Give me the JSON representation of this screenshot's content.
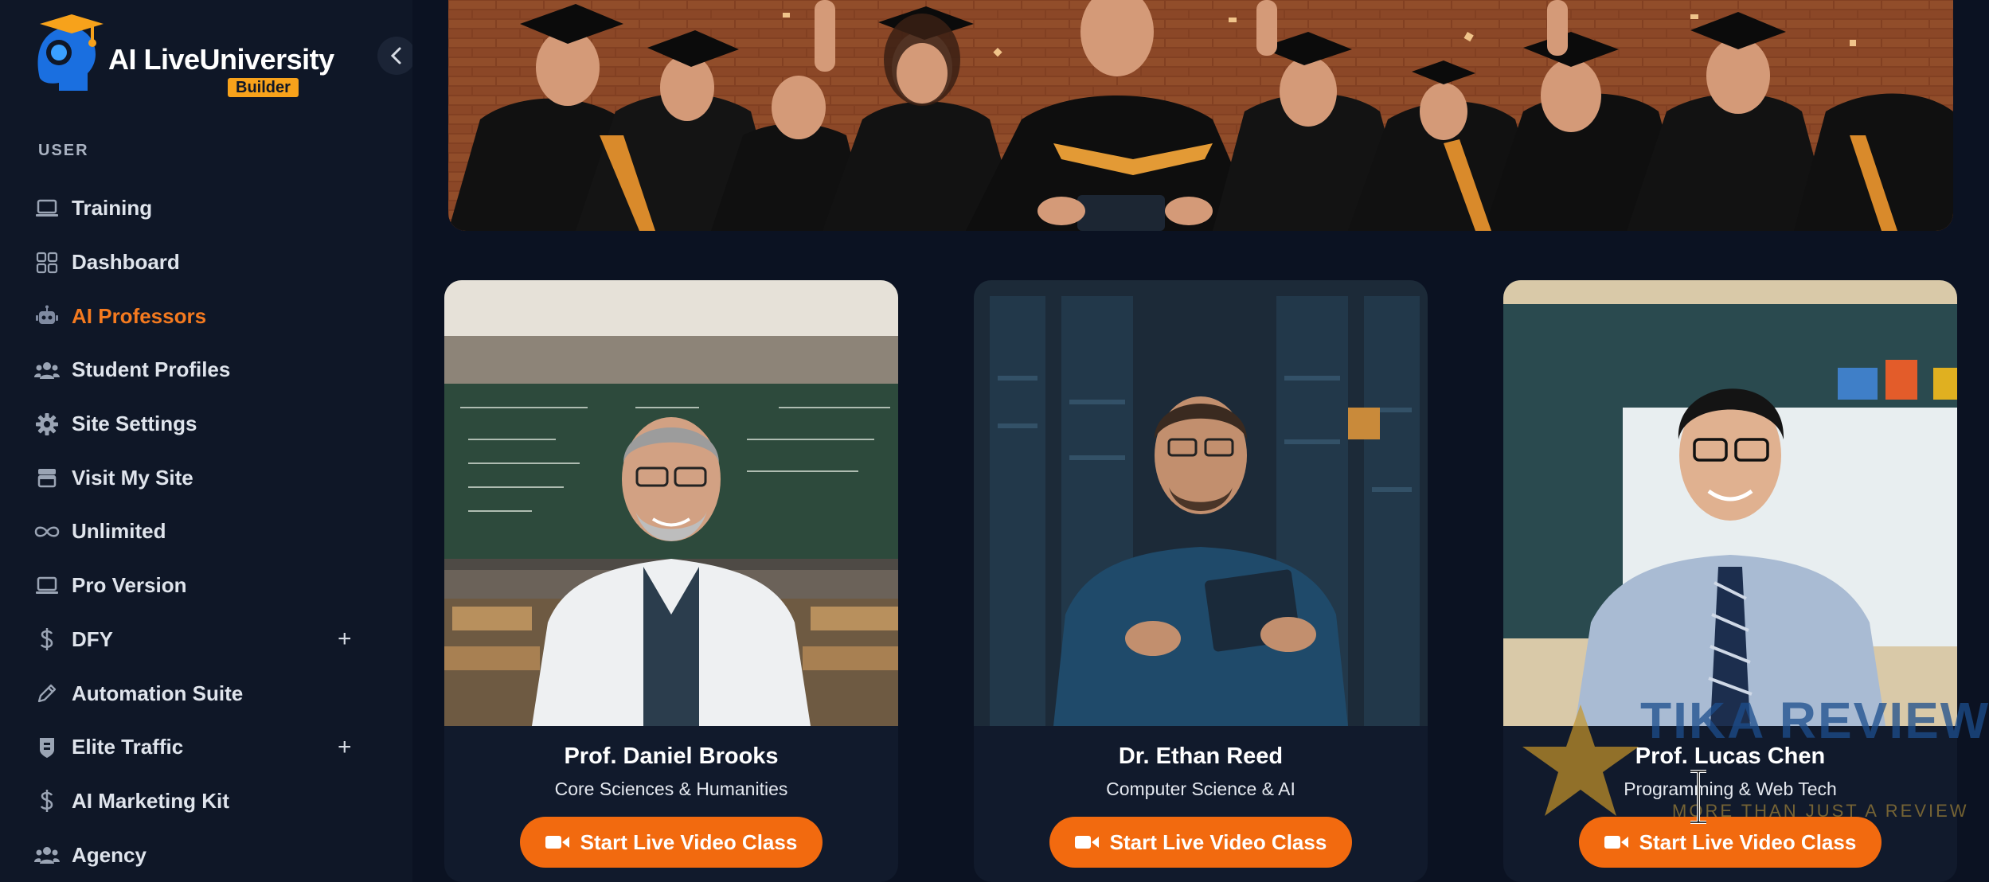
{
  "brand": {
    "name": "AI LiveUniversity",
    "sub": "Builder",
    "accent": "#f47a1f"
  },
  "sidebar": {
    "section_label": "USER",
    "items": [
      {
        "label": "Training",
        "icon": "laptop-icon"
      },
      {
        "label": "Dashboard",
        "icon": "grid-icon"
      },
      {
        "label": "AI Professors",
        "icon": "robot-icon",
        "active": true
      },
      {
        "label": "Student Profiles",
        "icon": "users-icon"
      },
      {
        "label": "Site Settings",
        "icon": "gear-icon"
      },
      {
        "label": "Visit My Site",
        "icon": "store-icon"
      },
      {
        "label": "Unlimited",
        "icon": "infinity-icon"
      },
      {
        "label": "Pro Version",
        "icon": "laptop-icon"
      },
      {
        "label": "DFY",
        "icon": "dollar-icon",
        "expandable": true
      },
      {
        "label": "Automation Suite",
        "icon": "pencil-icon"
      },
      {
        "label": "Elite Traffic",
        "icon": "shield-icon",
        "expandable": true
      },
      {
        "label": "AI Marketing Kit",
        "icon": "dollar-icon"
      },
      {
        "label": "Agency",
        "icon": "users-icon"
      }
    ],
    "expand_symbol": "+"
  },
  "professors": [
    {
      "name": "Prof. Daniel Brooks",
      "subject": "Core Sciences & Humanities",
      "button": "Start Live Video Class"
    },
    {
      "name": "Dr. Ethan Reed",
      "subject": "Computer Science & AI",
      "button": "Start Live Video Class"
    },
    {
      "name": "Prof. Lucas Chen",
      "subject": "Programming & Web Tech",
      "button": "Start Live Video Class"
    }
  ],
  "watermark": {
    "text": "TIKA REVIEW",
    "tagline": "MORE THAN JUST A REVIEW"
  }
}
